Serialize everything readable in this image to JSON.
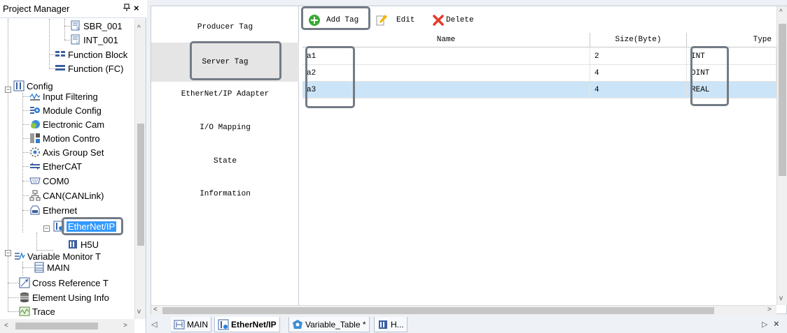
{
  "project_manager": {
    "title": "Project Manager",
    "pin_glyph": "\u0002",
    "close_glyph": "×",
    "tree": [
      {
        "label": "SBR_001",
        "icon": "subroutine-icon"
      },
      {
        "label": "INT_001",
        "icon": "interrupt-icon"
      },
      {
        "label": "Function Block",
        "icon": "function-block-icon"
      },
      {
        "label": "Function (FC)",
        "icon": "function-icon"
      },
      {
        "label": "Config",
        "icon": "config-icon"
      },
      {
        "label": "Input Filtering",
        "icon": "input-filter-icon"
      },
      {
        "label": "Module Config",
        "icon": "module-config-icon"
      },
      {
        "label": "Electronic Cam",
        "icon": "electronic-cam-icon"
      },
      {
        "label": "Motion Contro",
        "icon": "motion-control-icon"
      },
      {
        "label": "Axis Group Set",
        "icon": "axis-group-icon"
      },
      {
        "label": "EtherCAT",
        "icon": "ethercat-icon"
      },
      {
        "label": "COM0",
        "icon": "com-port-icon"
      },
      {
        "label": "CAN(CANLink)",
        "icon": "can-icon"
      },
      {
        "label": "Ethernet",
        "icon": "ethernet-icon"
      },
      {
        "label": "EtherNet/IP",
        "icon": "ethernet-ip-icon"
      },
      {
        "label": "H5U",
        "icon": "plc-device-icon"
      },
      {
        "label": "Variable Monitor T",
        "icon": "variable-monitor-icon"
      },
      {
        "label": "MAIN",
        "icon": "table-icon"
      },
      {
        "label": "Cross Reference T",
        "icon": "cross-reference-icon"
      },
      {
        "label": "Element Using Info",
        "icon": "element-usage-icon"
      },
      {
        "label": "Trace",
        "icon": "trace-icon"
      }
    ]
  },
  "nav": {
    "items": [
      {
        "label": "Producer Tag"
      },
      {
        "label": "Server Tag"
      },
      {
        "label": "EtherNet/IP Adapter"
      },
      {
        "label": "I/O Mapping"
      },
      {
        "label": "State"
      },
      {
        "label": "Information"
      }
    ],
    "selected": "Server Tag"
  },
  "toolbar": {
    "add_label": "Add Tag",
    "edit_label": "Edit",
    "delete_label": "Delete"
  },
  "grid": {
    "columns": [
      "Name",
      "Size(Byte)",
      "Type"
    ],
    "rows": [
      {
        "name": "a1",
        "size": "2",
        "type": "INT"
      },
      {
        "name": "a2",
        "size": "4",
        "type": "DINT"
      },
      {
        "name": "a3",
        "size": "4",
        "type": "REAL"
      }
    ],
    "selected_row": 3
  },
  "tabs": [
    {
      "label": "MAIN",
      "icon": "ladder-icon"
    },
    {
      "label": "EtherNet/IP",
      "icon": "ethernet-ip-icon",
      "active": true
    },
    {
      "label": "Variable_Table *",
      "icon": "variable-table-icon"
    },
    {
      "label": "H...",
      "icon": "plc-device-icon"
    }
  ],
  "colors": {
    "selected_row": "#cce4f7",
    "selected_nav": "#e5e5e5",
    "tree_selected": "#3399ff",
    "highlight_box": "#737b85",
    "add_icon": "#3aaa35",
    "delete_icon": "#e43b2c"
  }
}
